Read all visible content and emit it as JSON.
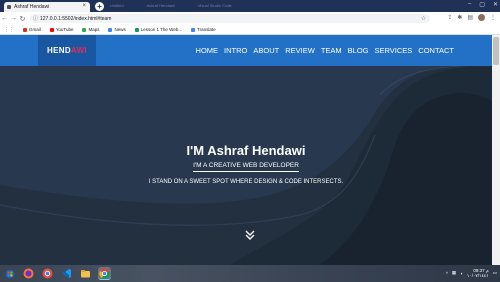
{
  "browser": {
    "active_tab_title": "Ashraf Hendawi",
    "ghost_tabs": [
      "Untitled",
      "Ashraf Hendawi",
      "Visual Studio Code"
    ],
    "url": "127.0.0.1:5502/index.html#team",
    "bookmarks": [
      {
        "label": "Gmail",
        "color": "#d93025"
      },
      {
        "label": "YouTube",
        "color": "#ff0000"
      },
      {
        "label": "Maps",
        "color": "#34a853"
      },
      {
        "label": "News",
        "color": "#4285f4"
      },
      {
        "label": "Lesson 1 The Web...",
        "color": "#0f9d58"
      },
      {
        "label": "Translate",
        "color": "#4285f4"
      }
    ]
  },
  "site": {
    "logo_part1": "HEND",
    "logo_part2": "AWI",
    "nav": [
      "HOME",
      "INTRO",
      "ABOUT",
      "REVIEW",
      "TEAM",
      "BLOG",
      "SERVICES",
      "CONTACT"
    ],
    "hero": {
      "title": "I'M Ashraf Hendawi",
      "subtitle": "I'M A CREATIVE WEB DEVELOPER",
      "tagline": "I STAND ON A SWEET SPOT WHERE DESIGN & CODE INTERSECTS."
    },
    "colors": {
      "navbar": "#2271c6",
      "logo_bg": "#1957a3",
      "logo_accent": "#e22d56",
      "hero_bg": "#27374d"
    }
  },
  "taskbar": {
    "apps": [
      "windows-start-icon",
      "firefox-icon",
      "chrome-alt-icon",
      "vscode-icon",
      "folder-icon",
      "chrome-icon"
    ],
    "time": "09:37 م",
    "date": "١٠/٠٧/١٤٤١"
  }
}
